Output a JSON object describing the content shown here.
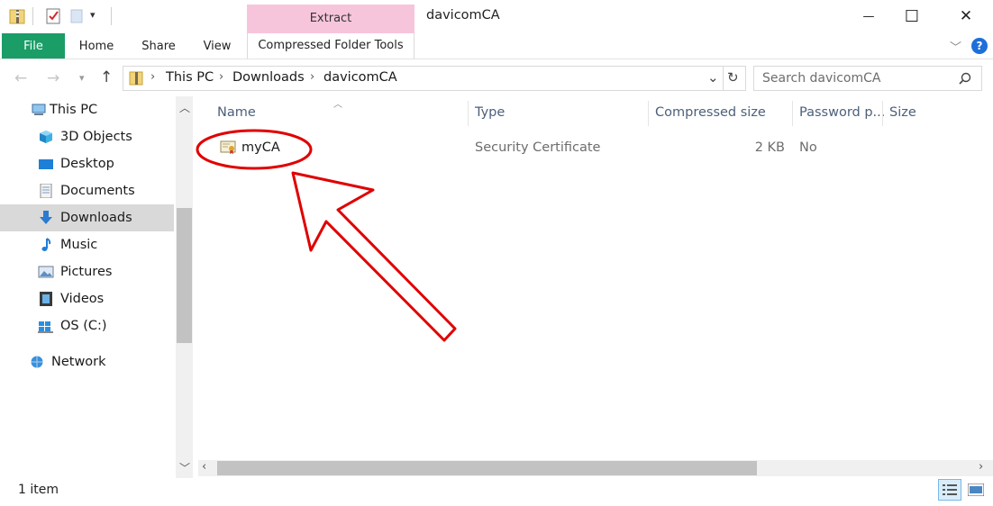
{
  "window": {
    "title": "davicomCA",
    "minimize": "—",
    "maximize": "☐",
    "close": "✕"
  },
  "ribbon": {
    "contextual_tab": "Extract",
    "contextual_group": "Compressed Folder Tools",
    "tabs": [
      "File",
      "Home",
      "Share",
      "View"
    ],
    "help": "?"
  },
  "address": {
    "crumbs": [
      "This PC",
      "Downloads",
      "davicomCA"
    ]
  },
  "search": {
    "placeholder": "Search davicomCA"
  },
  "nav": {
    "items": [
      {
        "label": "This PC",
        "icon": "pc-icon"
      },
      {
        "label": "3D Objects",
        "icon": "cube-icon"
      },
      {
        "label": "Desktop",
        "icon": "desktop-icon"
      },
      {
        "label": "Documents",
        "icon": "document-icon"
      },
      {
        "label": "Downloads",
        "icon": "download-icon",
        "selected": true
      },
      {
        "label": "Music",
        "icon": "music-icon"
      },
      {
        "label": "Pictures",
        "icon": "picture-icon"
      },
      {
        "label": "Videos",
        "icon": "video-icon"
      },
      {
        "label": "OS (C:)",
        "icon": "drive-icon"
      },
      {
        "label": "Network",
        "icon": "network-icon"
      }
    ]
  },
  "columns": [
    "Name",
    "Type",
    "Compressed size",
    "Password p...",
    "Size"
  ],
  "files": [
    {
      "name": "myCA",
      "type": "Security Certificate",
      "compressed_size": "2 KB",
      "password": "No",
      "icon": "certificate-icon"
    }
  ],
  "status": {
    "count": "1 item"
  },
  "colors": {
    "file_tab": "#1a9d67",
    "contextual_tab": "#f7c5db",
    "annotation": "#e00000",
    "selection": "#d9d9d9"
  }
}
